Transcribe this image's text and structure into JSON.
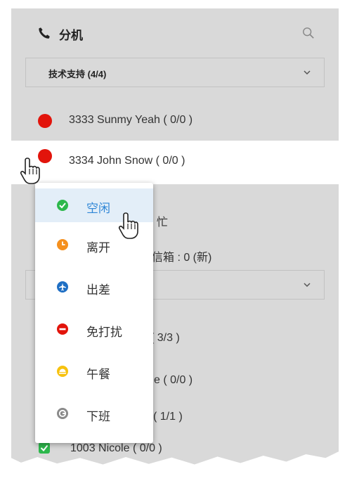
{
  "header": {
    "title": "分机",
    "phone_icon": "phone-icon",
    "search_icon": "search-icon"
  },
  "group_select": {
    "value": "技术支持 (4/4)"
  },
  "extensions": [
    {
      "label": "3333 Sunmy Yeah ( 0/0 )",
      "status_color": "#e2140b"
    },
    {
      "label": "3334 John Snow ( 0/0 )",
      "status_color": "#e2140b"
    }
  ],
  "background_fragments": {
    "busy": ": 忙",
    "voicemail": "信箱 : 0 (新)",
    "count_a": "( 3/3 )",
    "count_b": "e ( 0/0 )",
    "count_c": "( 1/1 )",
    "last_ext": "1003 Nicole ( 0/0 )"
  },
  "status_menu": [
    {
      "label": "空闲",
      "icon": "check-circle-icon",
      "color": "#2db84c",
      "active": true
    },
    {
      "label": "离开",
      "icon": "clock-icon",
      "color": "#f5901e",
      "active": false
    },
    {
      "label": "出差",
      "icon": "airplane-icon",
      "color": "#1f6fc4",
      "active": false
    },
    {
      "label": "免打扰",
      "icon": "do-not-disturb-icon",
      "color": "#e2140b",
      "active": false
    },
    {
      "label": "午餐",
      "icon": "lunch-icon",
      "color": "#f7c20f",
      "active": false
    },
    {
      "label": "下班",
      "icon": "off-work-icon",
      "color": "#8a8a8a",
      "active": false
    }
  ],
  "colors": {
    "panel_bg": "#d9d9d9",
    "accent": "#2f86d6",
    "highlight": "#e3eef8"
  }
}
